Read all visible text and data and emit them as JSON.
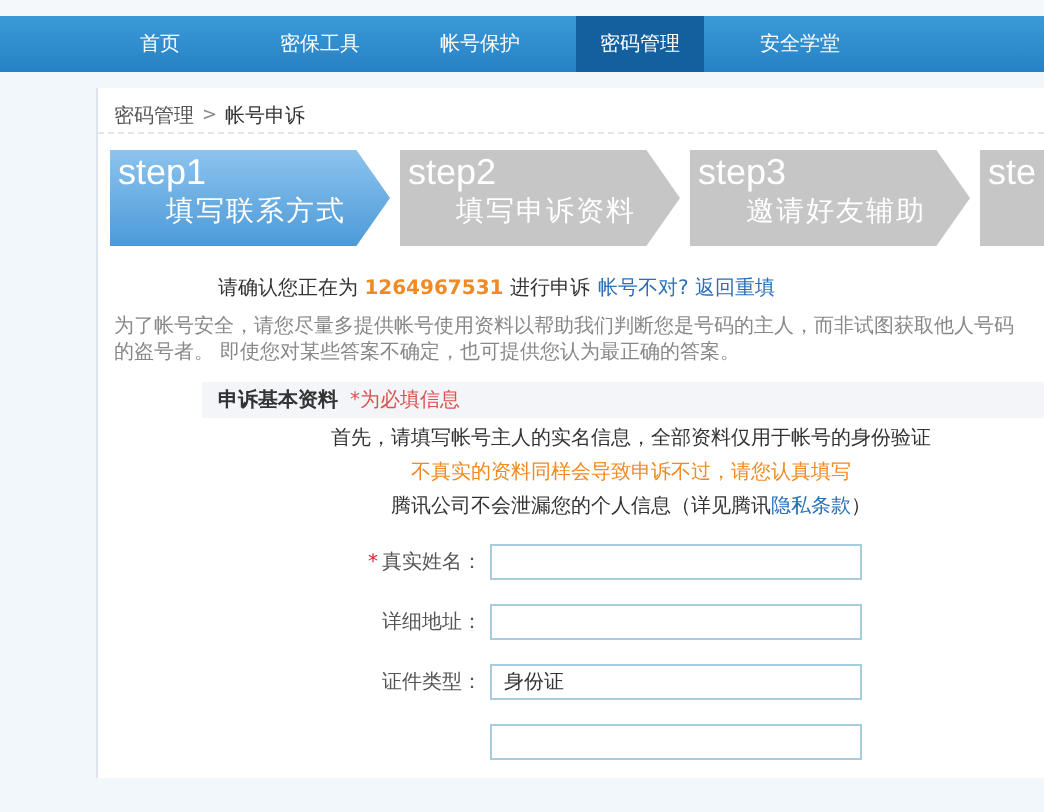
{
  "nav": [
    {
      "label": "首页",
      "selected": false
    },
    {
      "label": "密保工具",
      "selected": false
    },
    {
      "label": "帐号保护",
      "selected": false
    },
    {
      "label": "密码管理",
      "selected": true
    },
    {
      "label": "安全学堂",
      "selected": false
    }
  ],
  "breadcrumb": {
    "parent": "密码管理",
    "separator": ">",
    "current": "帐号申诉"
  },
  "steps": [
    {
      "step": "step1",
      "label": "填写联系方式",
      "selected": true
    },
    {
      "step": "step2",
      "label": "填写申诉资料",
      "selected": false
    },
    {
      "step": "step3",
      "label": "邀请好友辅助",
      "selected": false
    },
    {
      "step": "ste",
      "selected": false
    }
  ],
  "confirm": {
    "prefix": "请确认您正在为",
    "account": "1264967531",
    "suffix": "进行申诉",
    "link": "帐号不对? 返回重填"
  },
  "intro": "为了帐号安全，请您尽量多提供帐号使用资料以帮助我们判断您是号码的主人，而非试图获取他人号码的盗号者。 即使您对某些答案不确定，也可提供您认为最正确的答案。",
  "section": {
    "title": "申诉基本资料",
    "note": "*为必填信息"
  },
  "notices": [
    {
      "kind": "normal",
      "text": "首先，请填写帐号主人的实名信息，全部资料仅用于帐号的身份验证"
    },
    {
      "kind": "warning",
      "text": "不真实的资料同样会导致申诉不过，请您认真填写"
    },
    {
      "kind": "privacy",
      "text": "腾讯公司不会泄漏您的个人信息（详见腾讯",
      "link": "隐私条款",
      "suffix": "）"
    }
  ],
  "fields": [
    {
      "label": "真实姓名：",
      "required": true,
      "mark": "*"
    },
    {
      "label": "详细地址：",
      "required": false
    },
    {
      "label": "证件类型：",
      "required": false,
      "value": "身份证"
    },
    {
      "required": false
    }
  ]
}
